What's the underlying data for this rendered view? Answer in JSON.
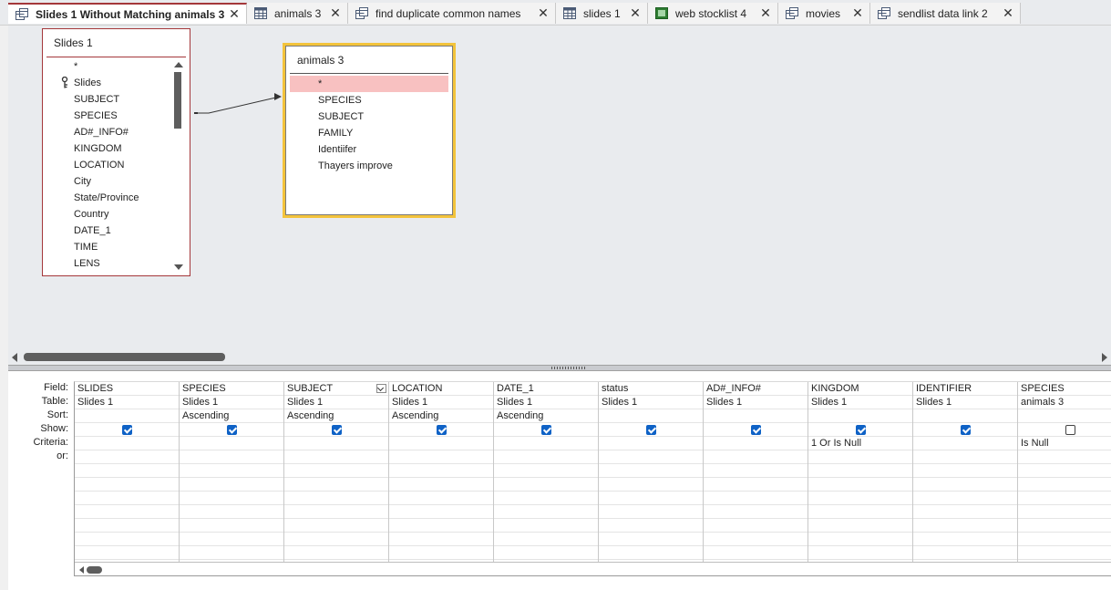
{
  "tabs": [
    {
      "label": "Slides 1 Without Matching animals 3",
      "icon": "query-icon",
      "active": true
    },
    {
      "label": "animals 3",
      "icon": "table-icon",
      "active": false
    },
    {
      "label": "find duplicate common names",
      "icon": "query-icon",
      "active": false
    },
    {
      "label": "slides 1",
      "icon": "table-icon",
      "active": false
    },
    {
      "label": "web stocklist 4",
      "icon": "form-icon",
      "active": false
    },
    {
      "label": "movies",
      "icon": "query-icon",
      "active": false
    },
    {
      "label": "sendlist data link 2",
      "icon": "query-icon",
      "active": false
    }
  ],
  "tab_close_glyph": "✕",
  "colors": {
    "accent": "#a4373a",
    "selected_table_border": "#f3c33b",
    "selected_field": "#f8c1c1",
    "checkbox": "#0f62c6"
  },
  "design": {
    "slides_table": {
      "title": "Slides 1",
      "fields": [
        "*",
        "Slides",
        "SUBJECT",
        "SPECIES",
        "AD#_INFO#",
        "KINGDOM",
        "LOCATION",
        "City",
        "State/Province",
        "Country",
        "DATE_1",
        "TIME",
        "LENS"
      ],
      "primary_key": "Slides"
    },
    "animals_table": {
      "title": "animals 3",
      "fields": [
        "*",
        "SPECIES",
        "SUBJECT",
        "FAMILY",
        "Identiifer",
        "Thayers improve"
      ],
      "selected_field": "*"
    }
  },
  "grid": {
    "row_labels": [
      "Field:",
      "Table:",
      "Sort:",
      "Show:",
      "Criteria:",
      "or:"
    ],
    "columns": [
      {
        "field": "SLIDES",
        "table": "Slides 1",
        "sort": "",
        "show": true,
        "criteria": "",
        "or": ""
      },
      {
        "field": "SPECIES",
        "table": "Slides 1",
        "sort": "Ascending",
        "show": true,
        "criteria": "",
        "or": ""
      },
      {
        "field": "SUBJECT",
        "table": "Slides 1",
        "sort": "Ascending",
        "show": true,
        "criteria": "",
        "or": "",
        "has_dropdown": true
      },
      {
        "field": "LOCATION",
        "table": "Slides 1",
        "sort": "Ascending",
        "show": true,
        "criteria": "",
        "or": ""
      },
      {
        "field": "DATE_1",
        "table": "Slides 1",
        "sort": "Ascending",
        "show": true,
        "criteria": "",
        "or": ""
      },
      {
        "field": "status",
        "table": "Slides 1",
        "sort": "",
        "show": true,
        "criteria": "",
        "or": ""
      },
      {
        "field": "AD#_INFO#",
        "table": "Slides 1",
        "sort": "",
        "show": true,
        "criteria": "",
        "or": ""
      },
      {
        "field": "KINGDOM",
        "table": "Slides 1",
        "sort": "",
        "show": true,
        "criteria": "1 Or Is Null",
        "or": ""
      },
      {
        "field": "IDENTIFIER",
        "table": "Slides 1",
        "sort": "",
        "show": true,
        "criteria": "",
        "or": ""
      },
      {
        "field": "SPECIES",
        "table": "animals 3",
        "sort": "",
        "show": false,
        "criteria": "Is Null",
        "or": ""
      }
    ]
  }
}
